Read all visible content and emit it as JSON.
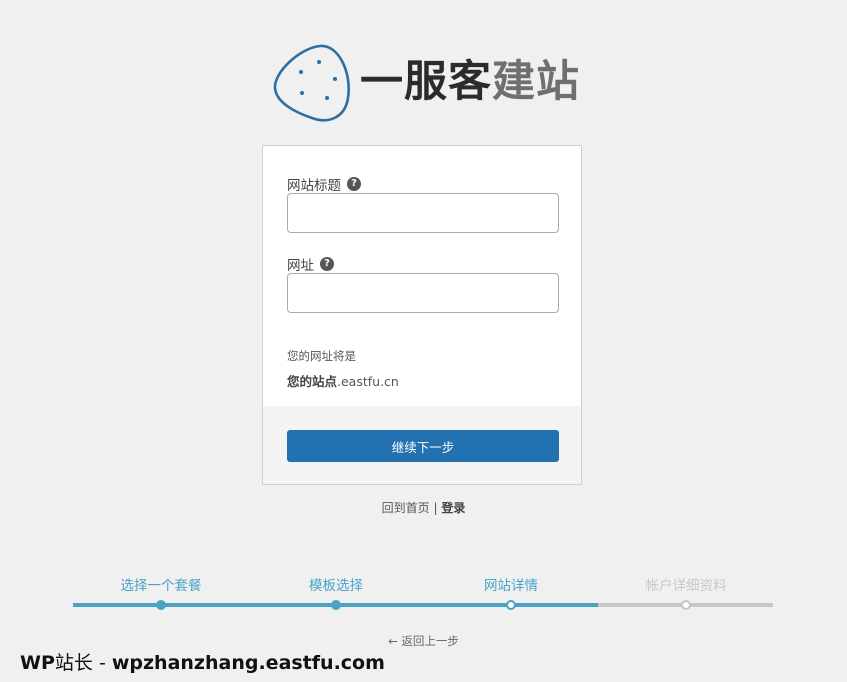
{
  "brand": {
    "name_dark": "一服客",
    "name_light": "建站",
    "logo_color": "#2b6fa3"
  },
  "form": {
    "site_title_label": "网站标题",
    "site_title_value": "",
    "site_url_label": "网址",
    "site_url_value": "",
    "url_note": "您的网址将是",
    "url_preview_strong": "您的站点",
    "url_preview_domain": ".eastfu.cn",
    "continue_button": "继续下一步"
  },
  "links": {
    "home": "回到首页",
    "separator": " | ",
    "login": "登录"
  },
  "progress": {
    "steps": [
      {
        "label": "选择一个套餐",
        "state": "done"
      },
      {
        "label": "模板选择",
        "state": "done"
      },
      {
        "label": "网站详情",
        "state": "current"
      },
      {
        "label": "帐户详细资料",
        "state": "todo"
      }
    ],
    "done_color": "#4aa3c7",
    "todo_color": "#c8c8c8"
  },
  "back": {
    "arrow": "←",
    "label": "返回上一步"
  },
  "watermark": {
    "prefix": "WP",
    "zh": "站长",
    "dash": " - ",
    "domain": "wpzhanzhang.eastfu.com"
  }
}
